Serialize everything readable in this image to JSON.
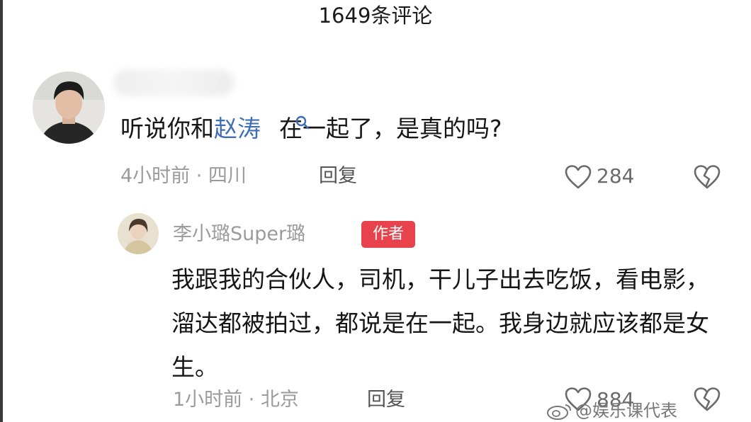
{
  "header": {
    "title": "1649条评论"
  },
  "comment": {
    "text_before": "听说你和",
    "link_text": "赵涛",
    "text_after": "在一起了，是真的吗?",
    "meta": "4小时前 · 四川",
    "reply_label": "回复",
    "likes": "284"
  },
  "reply": {
    "username": "李小璐Super璐",
    "badge": "作者",
    "text": "我跟我的合伙人，司机，干儿子出去吃饭，看电影，溜达都被拍过，都说是在一起。我身边就应该都是女生。",
    "meta": "1小时前 · 北京",
    "reply_label": "回复",
    "likes": "884"
  },
  "watermark": {
    "text": "@娱乐课代表"
  },
  "colors": {
    "link": "#3f6eb7",
    "badge": "#e8424d",
    "meta": "#9b9b9b"
  },
  "icons": [
    "search-icon",
    "heart-icon",
    "broken-heart-icon",
    "weibo-icon"
  ]
}
